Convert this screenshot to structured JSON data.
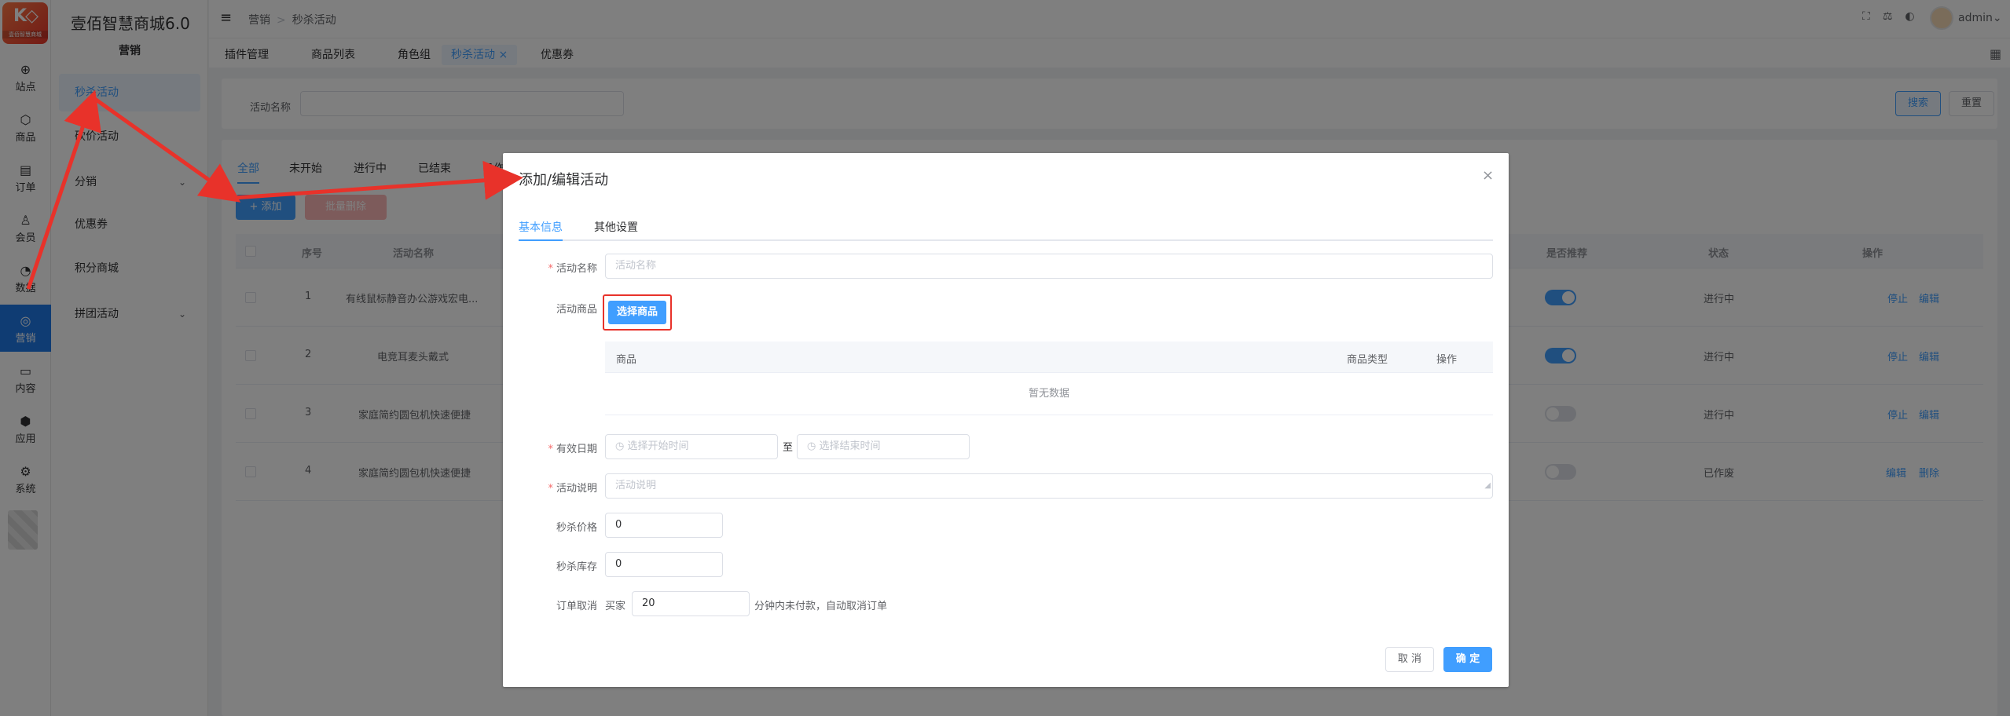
{
  "app": {
    "logo_subtitle": "壹佰智慧商城",
    "brand_title": "壹佰智慧商城6.0",
    "section_title": "营销"
  },
  "icon_nav": [
    {
      "label": "站点",
      "icon": "globe-icon"
    },
    {
      "label": "商品",
      "icon": "box-icon"
    },
    {
      "label": "订单",
      "icon": "clipboard-icon"
    },
    {
      "label": "会员",
      "icon": "user-icon"
    },
    {
      "label": "数据",
      "icon": "pie-chart-icon"
    },
    {
      "label": "营销",
      "icon": "target-icon",
      "active": true
    },
    {
      "label": "内容",
      "icon": "folder-icon"
    },
    {
      "label": "应用",
      "icon": "cube-icon"
    },
    {
      "label": "系统",
      "icon": "gear-icon"
    }
  ],
  "sub_nav": [
    {
      "label": "秒杀活动",
      "active": true
    },
    {
      "label": "砍价活动"
    },
    {
      "label": "分销",
      "has_children": true
    },
    {
      "label": "优惠券"
    },
    {
      "label": "积分商城"
    },
    {
      "label": "拼团活动",
      "has_children": true
    }
  ],
  "header": {
    "breadcrumb": [
      "营销",
      "秒杀活动"
    ],
    "user": "admin"
  },
  "tags": [
    {
      "label": "插件管理"
    },
    {
      "label": "商品列表"
    },
    {
      "label": "角色组"
    },
    {
      "label": "秒杀活动",
      "active": true,
      "closable": true
    },
    {
      "label": "优惠券"
    }
  ],
  "search": {
    "label": "活动名称",
    "search_btn": "搜索",
    "reset_btn": "重置"
  },
  "list": {
    "tabs": [
      "全部",
      "未开始",
      "进行中",
      "已结束",
      "已作"
    ],
    "add_btn": "+ 添加",
    "batch_delete_btn": "批量删除",
    "columns": [
      "序号",
      "活动名称",
      "是否推荐",
      "状态",
      "操作"
    ],
    "rows": [
      {
        "no": "1",
        "name": "有线鼠标静音办公游戏宏电...",
        "recommend": true,
        "status": "进行中",
        "actions": [
          "停止",
          "编辑"
        ]
      },
      {
        "no": "2",
        "name": "电竞耳麦头戴式",
        "recommend": true,
        "status": "进行中",
        "actions": [
          "停止",
          "编辑"
        ]
      },
      {
        "no": "3",
        "name": "家庭简约圆包机快速便捷",
        "recommend": false,
        "status": "进行中",
        "actions": [
          "停止",
          "编辑"
        ]
      },
      {
        "no": "4",
        "name": "家庭简约圆包机快速便捷",
        "recommend": false,
        "status": "已作废",
        "actions": [
          "编辑",
          "删除"
        ]
      }
    ]
  },
  "dialog": {
    "title": "添加/编辑活动",
    "tabs": [
      "基本信息",
      "其他设置"
    ],
    "fields": {
      "name_label": "活动名称",
      "name_placeholder": "活动名称",
      "goods_label": "活动商品",
      "pick_goods_btn": "选择商品",
      "goods_columns": [
        "商品",
        "商品类型",
        "操作"
      ],
      "goods_empty": "暂无数据",
      "date_label": "有效日期",
      "start_placeholder": "选择开始时间",
      "to": "至",
      "end_placeholder": "选择结束时间",
      "desc_label": "活动说明",
      "desc_placeholder": "活动说明",
      "price_label": "秒杀价格",
      "price_value": "0",
      "stock_label": "秒杀库存",
      "stock_value": "0",
      "cancel_label": "订单取消",
      "cancel_prefix": "买家",
      "cancel_minutes": "20",
      "cancel_suffix": "分钟内未付款，自动取消订单"
    },
    "cancel_btn": "取 消",
    "ok_btn": "确 定"
  },
  "colors": {
    "primary": "#409eff",
    "active_nav": "#1e78e6",
    "annotation": "#e8322a"
  }
}
